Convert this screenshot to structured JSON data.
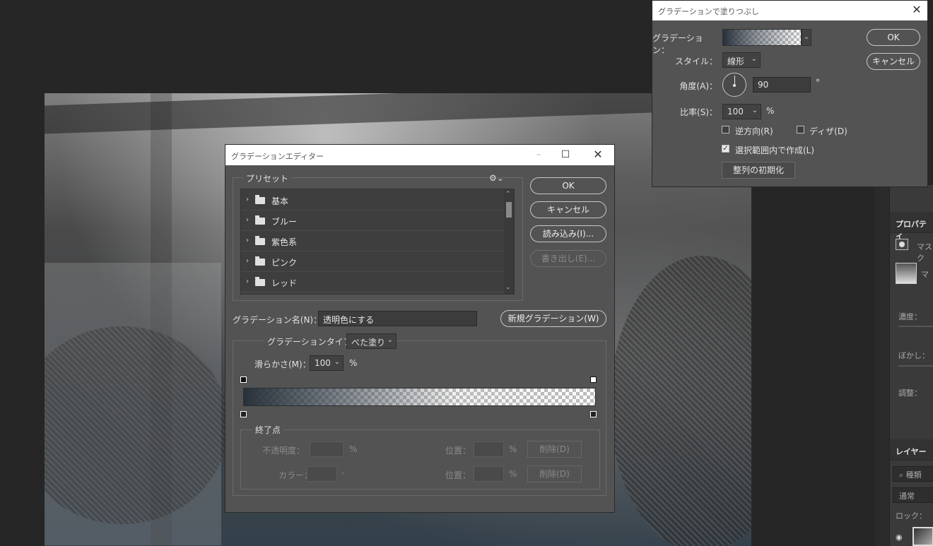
{
  "fill_dialog": {
    "title": "グラデーションで塗りつぶし",
    "gradient_label": "グラデーション：",
    "style_label": "スタイル：",
    "style_value": "線形",
    "angle_label": "角度(A)：",
    "angle_value": "90",
    "angle_unit": "°",
    "scale_label": "比率(S)：",
    "scale_value": "100",
    "scale_unit": "%",
    "reverse_label": "逆方向(R)",
    "dither_label": "ディザ(D)",
    "align_label": "選択範囲内で作成(L)",
    "reset_align_label": "整列の初期化",
    "ok_label": "OK",
    "cancel_label": "キャンセル"
  },
  "editor": {
    "title": "グラデーションエディター",
    "presets_label": "プリセット",
    "presets": [
      "基本",
      "ブルー",
      "紫色系",
      "ピンク",
      "レッド"
    ],
    "ok_label": "OK",
    "cancel_label": "キャンセル",
    "load_label": "読み込み(I)...",
    "export_label": "書き出し(E)...",
    "name_label": "グラデーション名(N)：",
    "name_value": "透明色にする",
    "new_gradient_label": "新規グラデーション(W)",
    "type_label": "グラデーションタイプ：",
    "type_value": "べた塗り",
    "smoothness_label": "滑らかさ(M)：",
    "smoothness_value": "100",
    "smoothness_unit": "%",
    "stops_label": "終了点",
    "opacity_label": "不透明度：",
    "opacity_unit": "%",
    "color_label": "カラー：",
    "location_label": "位置：",
    "location_unit": "%",
    "delete_label": "削除(D)"
  },
  "properties_panel": {
    "tab": "プロパティ",
    "mask_label_1": "マスク",
    "mask_label_2": "マ",
    "density_label": "濃度：",
    "feather_label": "ぼかし：",
    "refine_label": "調整："
  },
  "layers_panel": {
    "tab": "レイヤー",
    "search_label": "種類",
    "blend_mode": "通常",
    "lock_label": "ロック："
  }
}
